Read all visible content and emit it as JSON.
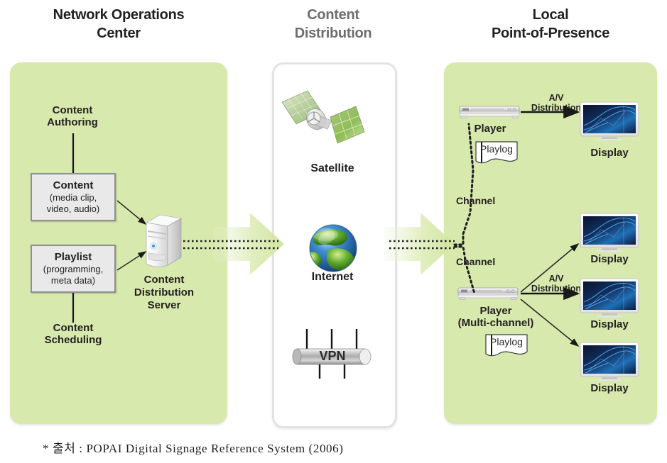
{
  "columns": [
    {
      "id": "noc",
      "title_line1": "Network Operations",
      "title_line2": "Center"
    },
    {
      "id": "dist",
      "title_line1": "Content",
      "title_line2": "Distribution"
    },
    {
      "id": "pop",
      "title_line1": "Local",
      "title_line2": "Point-of-Presence"
    }
  ],
  "noc": {
    "authoring": {
      "line1": "Content",
      "line2": "Authoring"
    },
    "content_box": {
      "title": "Content",
      "sub_line1": "(media clip,",
      "sub_line2": "video, audio)"
    },
    "playlist_box": {
      "title": "Playlist",
      "sub_line1": "(programming,",
      "sub_line2": "meta data)"
    },
    "scheduling": {
      "line1": "Content",
      "line2": "Scheduling"
    },
    "server": {
      "line1": "Content",
      "line2": "Distribution",
      "line3": "Server",
      "icon": "server-tower-icon"
    }
  },
  "distribution": {
    "items": [
      {
        "id": "satellite",
        "label": "Satellite",
        "icon": "satellite-icon"
      },
      {
        "id": "internet",
        "label": "Internet",
        "icon": "globe-icon"
      },
      {
        "id": "vpn",
        "label": "VPN",
        "icon": "vpn-tunnel-icon"
      }
    ]
  },
  "pop": {
    "player_single": {
      "label": "Player",
      "icon": "media-player-icon"
    },
    "player_multi": {
      "line1": "Player",
      "line2": "(Multi-channel)",
      "icon": "media-player-icon"
    },
    "playlog_label": "Playlog",
    "display_label": "Display",
    "av_label_line1": "A/V",
    "av_label_line2": "Distribution",
    "channel_label": "Channel",
    "displays": [
      {
        "id": "display-1",
        "label": "Display"
      },
      {
        "id": "display-2",
        "label": "Display"
      },
      {
        "id": "display-3",
        "label": "Display"
      },
      {
        "id": "display-4",
        "label": "Display"
      }
    ]
  },
  "footer": {
    "text": "* 출처 : POPAI Digital Signage Reference System (2006)"
  },
  "colors": {
    "panel_green": "#d8e9ad",
    "panel_white": "#ffffff",
    "panel_white_border": "#e3e3e3",
    "box_fill": "#e9e9e9",
    "box_border": "#8f8f8f",
    "flow_arrow": "#e4efc8",
    "text": "#231f20",
    "title_muted": "#6e6e6e",
    "display_screen": "#0b1b3d"
  }
}
